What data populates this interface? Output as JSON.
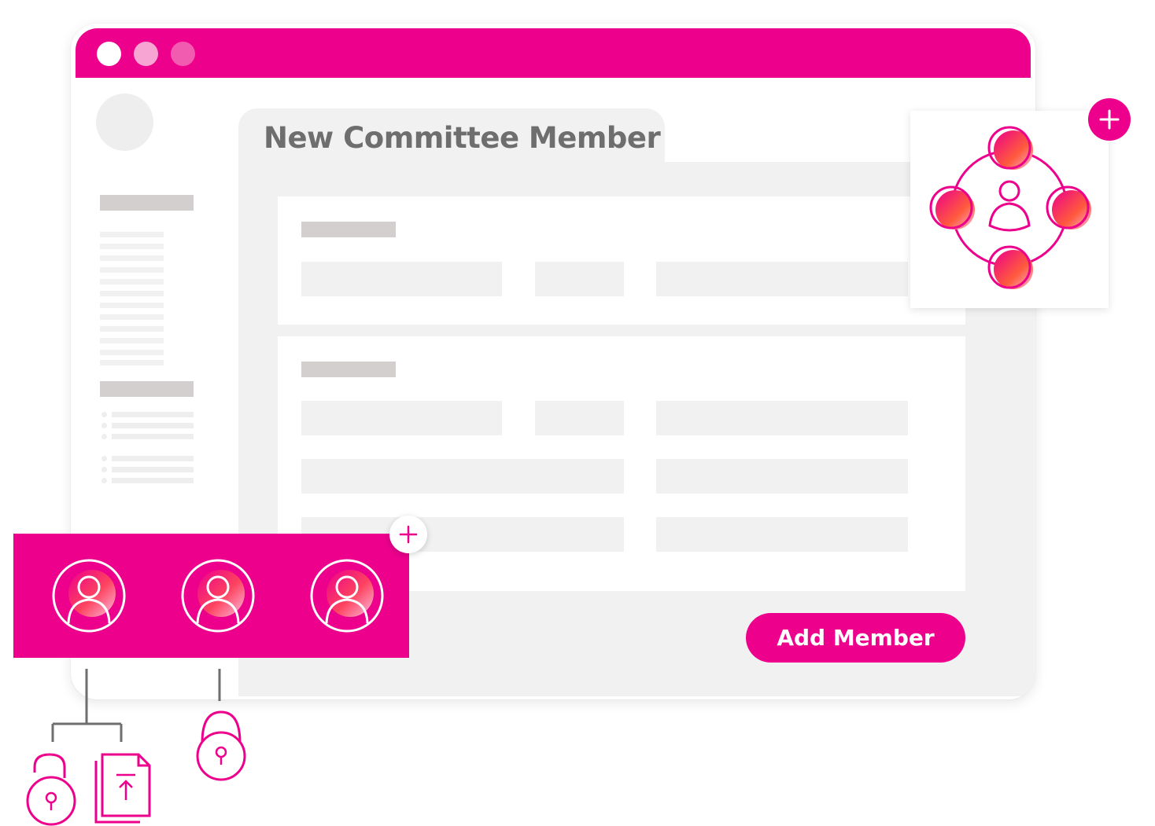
{
  "window": {
    "title_dots": [
      "close",
      "minimize",
      "maximize"
    ]
  },
  "form": {
    "title": "New Committee Member",
    "add_button_label": "Add Member"
  },
  "members_strip": {
    "avatar_count": 3
  },
  "icons": {
    "team_icon": "team-network-icon",
    "member_icon": "user-icon",
    "plus_icon": "plus-icon",
    "lock_icon": "unlock-icon",
    "document_icon": "document-upload-icon"
  },
  "colors": {
    "brand": "#ec008c",
    "placeholder": "#f1f1f1",
    "placeholder_dark": "#d3cfcf",
    "title_text": "#6e6e6e"
  }
}
